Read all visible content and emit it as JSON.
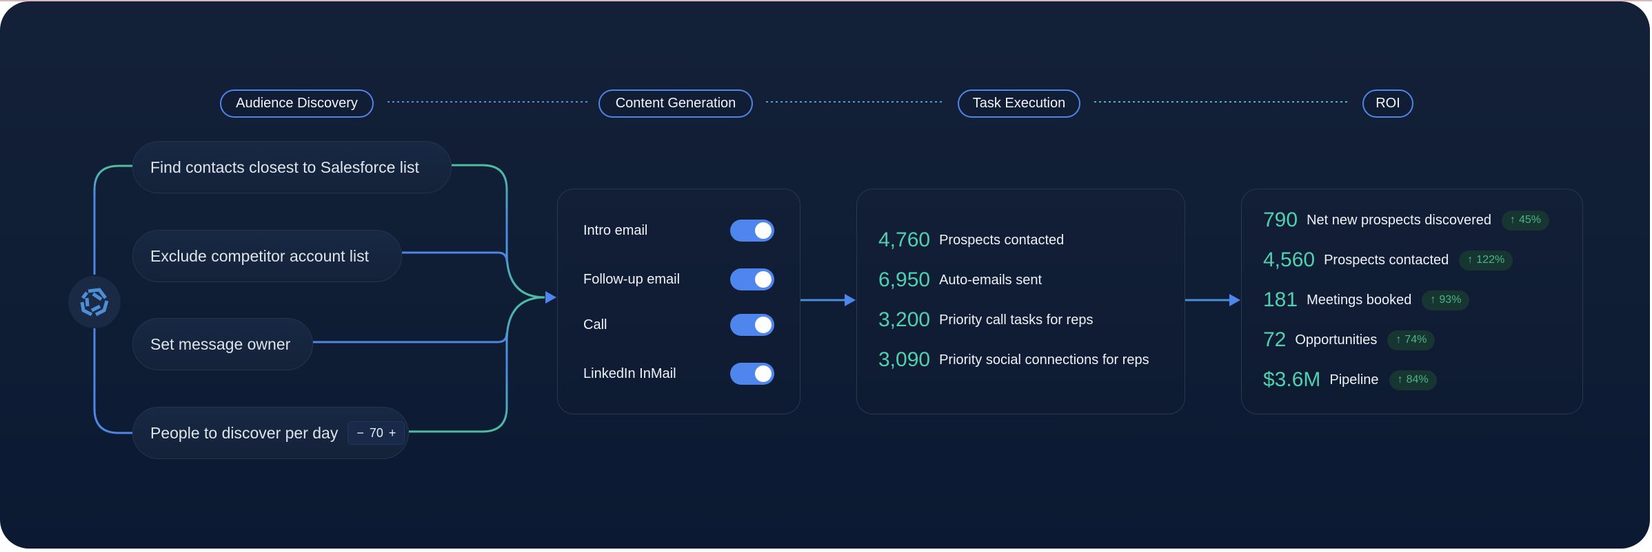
{
  "stages": [
    {
      "label": "Audience Discovery"
    },
    {
      "label": "Content Generation"
    },
    {
      "label": "Task Execution"
    },
    {
      "label": "ROI"
    }
  ],
  "audience": {
    "logo_icon": "hexagon-swirl-logo-icon",
    "options": [
      {
        "label": "Find contacts closest to Salesforce list"
      },
      {
        "label": "Exclude competitor account list"
      },
      {
        "label": "Set message owner"
      },
      {
        "label": "People to discover per day"
      }
    ],
    "stepper": {
      "minus": "−",
      "value": "70",
      "plus": "+"
    }
  },
  "content_generation": {
    "channels": [
      {
        "label": "Intro email",
        "enabled": true
      },
      {
        "label": "Follow-up email",
        "enabled": true
      },
      {
        "label": "Call",
        "enabled": true
      },
      {
        "label": "LinkedIn InMail",
        "enabled": true
      }
    ]
  },
  "task_execution": {
    "stats": [
      {
        "value": "4,760",
        "label": "Prospects contacted"
      },
      {
        "value": "6,950",
        "label": "Auto-emails sent"
      },
      {
        "value": "3,200",
        "label": "Priority call tasks for reps"
      },
      {
        "value": "3,090",
        "label": "Priority social connections for reps"
      }
    ]
  },
  "roi": {
    "stats": [
      {
        "value": "790",
        "label": "Net new prospects discovered",
        "change": "45%"
      },
      {
        "value": "4,560",
        "label": "Prospects contacted",
        "change": "122%"
      },
      {
        "value": "181",
        "label": "Meetings booked",
        "change": "93%"
      },
      {
        "value": "72",
        "label": "Opportunities",
        "change": "74%"
      },
      {
        "value": "$3.6M",
        "label": "Pipeline",
        "change": "84%"
      }
    ],
    "arrow_glyph": "↑"
  },
  "colors": {
    "accent_blue": "#4f86ee",
    "accent_teal": "#4fd1b0",
    "badge_green": "#4bb686"
  }
}
